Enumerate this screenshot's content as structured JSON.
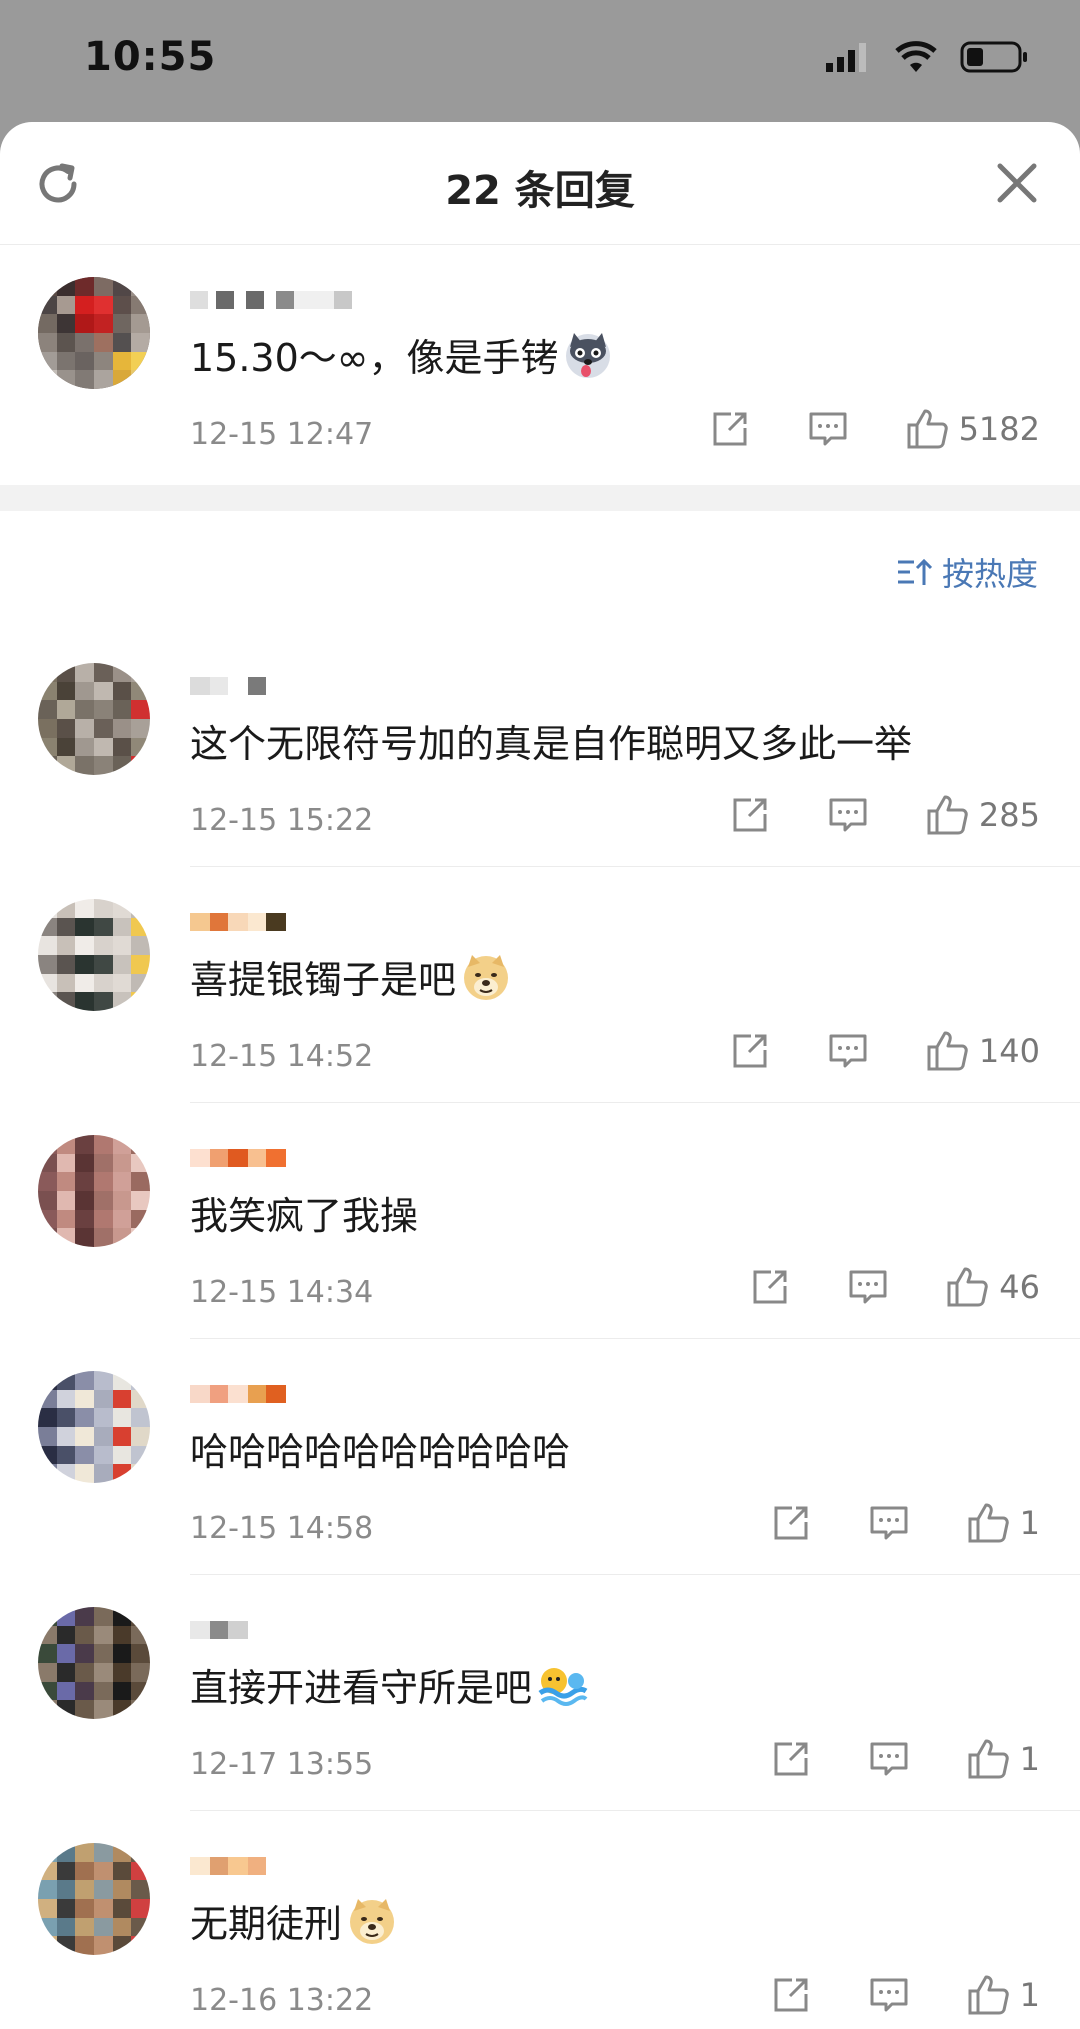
{
  "status": {
    "time": "10:55"
  },
  "header": {
    "title": "22 条回复",
    "refresh_icon": "refresh-icon",
    "close_icon": "close-icon"
  },
  "root_comment": {
    "text": "15.30～∞，像是手铐",
    "emoji": "husky-emoji",
    "time": "12-15 12:47",
    "likes": "5182"
  },
  "sort": {
    "label": "按热度",
    "icon": "sort-icon"
  },
  "replies": [
    {
      "text": "这个无限符号加的真是自作聪明又多此一举",
      "emoji": "",
      "time": "12-15 15:22",
      "likes": "285"
    },
    {
      "text": "喜提银镯子是吧",
      "emoji": "doge-emoji",
      "time": "12-15 14:52",
      "likes": "140"
    },
    {
      "text": "我笑疯了我操",
      "emoji": "",
      "time": "12-15 14:34",
      "likes": "46"
    },
    {
      "text": "哈哈哈哈哈哈哈哈哈哈",
      "emoji": "",
      "time": "12-15 14:58",
      "likes": "1"
    },
    {
      "text": "直接开进看守所是吧",
      "emoji": "swim-emoji",
      "time": "12-17 13:55",
      "likes": "1"
    },
    {
      "text": "无期徒刑",
      "emoji": "doge-emoji",
      "time": "12-16 13:22",
      "likes": "1"
    }
  ],
  "colors": {
    "link_blue": "#4a78b5",
    "meta_gray": "#8a8a8a",
    "backdrop": "#9a9a9a"
  }
}
